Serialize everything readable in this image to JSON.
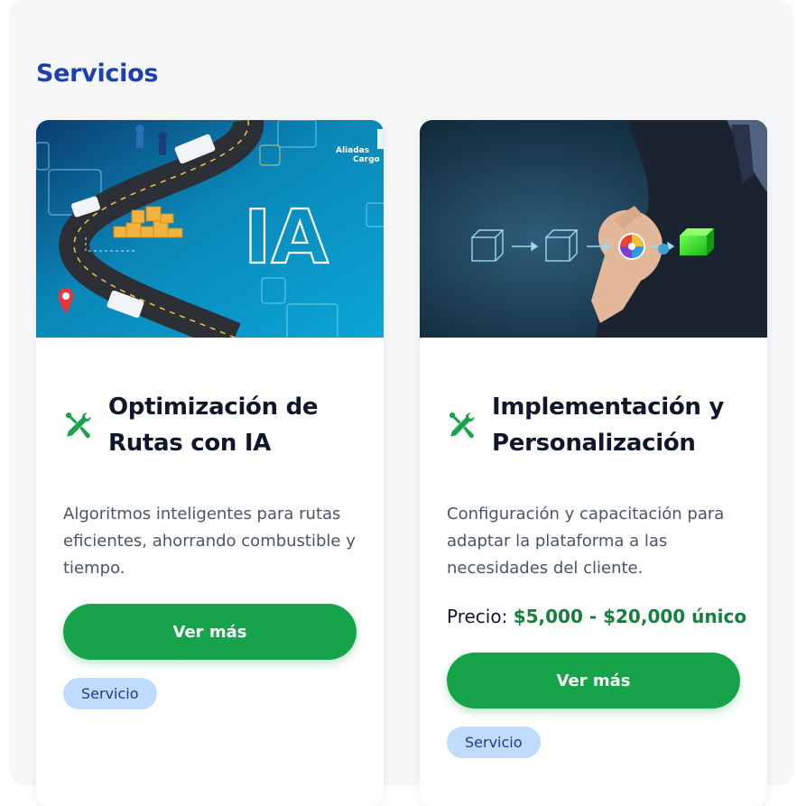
{
  "section": {
    "title": "Servicios"
  },
  "cards": [
    {
      "image_text": "IA",
      "logo_line1": "Aliadas",
      "logo_line2": "Cargo",
      "title_line1": "Optimización de",
      "title_line2": "Rutas con IA",
      "description": "Algoritmos inteligentes para rutas eficientes, ahorrando combustible y tiempo.",
      "button_label": "Ver más",
      "badge": "Servicio"
    },
    {
      "title_line1": "Implementación y",
      "title_line2": "Personalización",
      "description": "Configuración y capacitación para adaptar la plataforma a las necesidades del cliente.",
      "price_label": "Precio:",
      "price_value": "$5,000 - $20,000 único",
      "button_label": "Ver más",
      "badge": "Servicio"
    }
  ],
  "colors": {
    "section_title": "#1e40af",
    "button": "#16a34a",
    "price": "#15803d",
    "badge_bg": "#bfdbfe",
    "badge_text": "#1e3a8a",
    "icon": "#16a34a"
  },
  "icons": {
    "card_heading": "tools-icon"
  }
}
